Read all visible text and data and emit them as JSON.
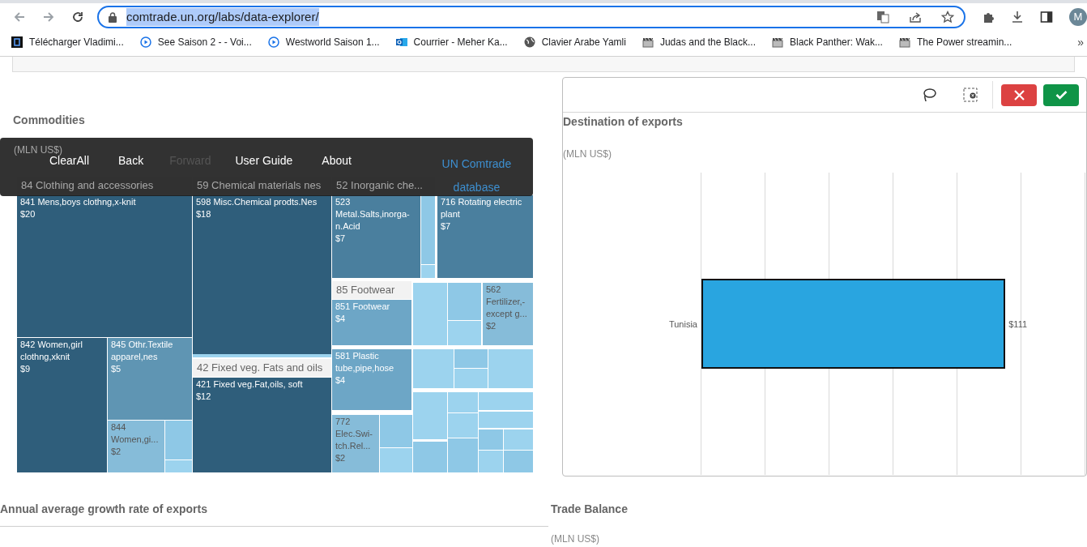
{
  "browser": {
    "url": "comtrade.un.org/labs/data-explorer/",
    "profile_initial": "M",
    "bookmarks": [
      {
        "kind": "s",
        "label": "Télécharger Vladimi..."
      },
      {
        "kind": "play",
        "label": "See Saison 2 - - Voi..."
      },
      {
        "kind": "play",
        "label": "Westworld Saison 1..."
      },
      {
        "kind": "outlook",
        "label": "Courrier - Meher Ka..."
      },
      {
        "kind": "globe",
        "label": "Clavier Arabe Yamli"
      },
      {
        "kind": "clapper",
        "label": "Judas and the Black..."
      },
      {
        "kind": "clapper",
        "label": "Black Panther: Wak..."
      },
      {
        "kind": "clapper",
        "label": "The Power streamin..."
      }
    ],
    "overflow": "»"
  },
  "nav_menu": [
    {
      "label": "ClearAll",
      "disabled": false,
      "kind": "item"
    },
    {
      "label": "Back",
      "disabled": false,
      "kind": "item"
    },
    {
      "label": "Forward",
      "disabled": true,
      "kind": "item"
    },
    {
      "label": "User Guide",
      "disabled": false,
      "kind": "item"
    },
    {
      "label": "About",
      "disabled": false,
      "kind": "item"
    },
    {
      "label": "UN Comtrade database",
      "disabled": false,
      "kind": "link"
    }
  ],
  "commodities": {
    "title": "Commodities",
    "unit": "(MLN US$)",
    "groups": [
      {
        "label": "84 Clothing and accessories"
      },
      {
        "label": "59 Chemical materials nes"
      },
      {
        "label": "52 Inorganic che..."
      },
      {
        "label": "42 Fixed veg. Fats and oils"
      },
      {
        "label": "85 Footwear"
      }
    ],
    "tiles": [
      {
        "label": "841 Mens,boys clothng,x-knit",
        "value": "$20",
        "color": "#2f5e7b"
      },
      {
        "label": "842 Women,girl clothng,xknit",
        "value": "$9",
        "color": "#2f5e7b"
      },
      {
        "label": "845 Othr.Textile apparel,nes",
        "value": "$5",
        "color": "#5f95b3"
      },
      {
        "label": "844 Women,gi...",
        "value": "$2",
        "color": "#86bcd9"
      },
      {
        "label": "598 Misc.Chemical prodts.Nes",
        "value": "$18",
        "color": "#2f5e7b"
      },
      {
        "label": "421 Fixed veg.Fat,oils, soft",
        "value": "$12",
        "color": "#2f5e7b"
      },
      {
        "label": "523 Metal.Salts,inorga-n.Acid",
        "value": "$7",
        "color": "#4a7f9e"
      },
      {
        "label": "716 Rotating electric plant",
        "value": "$7",
        "color": "#4a7f9e"
      },
      {
        "label": "851 Footwear",
        "value": "$4",
        "color": "#6da6c6"
      },
      {
        "label": "562 Fertilizer,-except g...",
        "value": "$2",
        "color": "#86bcd9"
      },
      {
        "label": "581 Plastic tube,pipe,hose",
        "value": "$4",
        "color": "#6da6c6"
      },
      {
        "label": "772 Elec.Swi-tch.Rel...",
        "value": "$2",
        "color": "#86bcd9"
      }
    ]
  },
  "destination": {
    "title": "Destination of exports",
    "unit": "(MLN US$)",
    "bars": [
      {
        "label": "Tunisia",
        "value": "$111",
        "level": 0.79
      }
    ]
  },
  "growth": {
    "title": "Annual average growth rate of exports"
  },
  "trade_balance": {
    "title": "Trade Balance",
    "unit": "(MLN US$)"
  }
}
